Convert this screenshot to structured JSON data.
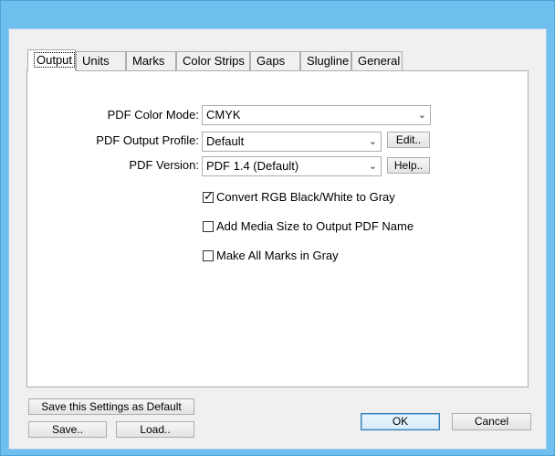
{
  "tabs": [
    "Output",
    "Units",
    "Marks",
    "Color Strips",
    "Gaps",
    "Slugline",
    "General"
  ],
  "form": {
    "color_mode": {
      "label": "PDF Color Mode:",
      "value": "CMYK"
    },
    "output_profile": {
      "label": "PDF Output Profile:",
      "value": "Default",
      "button": "Edit.."
    },
    "pdf_version": {
      "label": "PDF Version:",
      "value": "PDF 1.4 (Default)",
      "button": "Help.."
    }
  },
  "checkboxes": [
    {
      "label": "Convert RGB Black/White to Gray",
      "checked": true
    },
    {
      "label": "Add Media Size to Output PDF Name",
      "checked": false
    },
    {
      "label": "Make All Marks in Gray",
      "checked": false
    }
  ],
  "footer": {
    "save_default": "Save this Settings as Default",
    "save": "Save..",
    "load": "Load..",
    "ok": "OK",
    "cancel": "Cancel"
  },
  "icons": {
    "dropdown": "chevron-down-icon",
    "check": "checkmark-icon"
  }
}
